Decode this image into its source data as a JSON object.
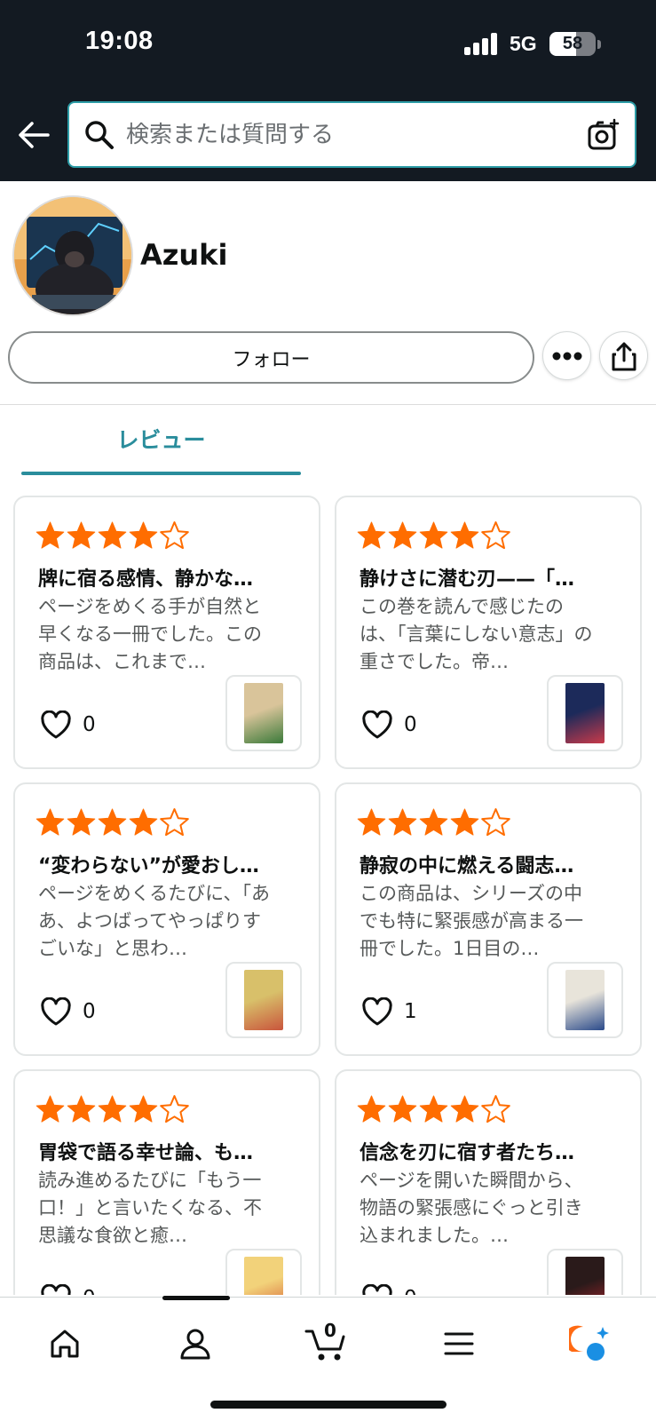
{
  "status_bar": {
    "time": "19:08",
    "network": "5G",
    "battery_percent": 58
  },
  "search": {
    "placeholder": "検索または質問する"
  },
  "profile": {
    "name": "Azuki",
    "follow_label": "フォロー"
  },
  "tabs": [
    {
      "label": "レビュー",
      "active": true
    }
  ],
  "reviews": [
    {
      "rating": 4,
      "title": "牌に宿る感情、静かな…",
      "body": "ページをめくる手が自然と早くなる一冊でした。この商品は、これまで…",
      "likes": "0",
      "cover_colors": [
        "#d9c49a",
        "#3b7a3a"
      ]
    },
    {
      "rating": 4,
      "title": "静けさに潜む刃——「…",
      "body": "この巻を読んで感じたのは、「言葉にしない意志」の重さでした。帝…",
      "likes": "0",
      "cover_colors": [
        "#1c2a5a",
        "#c93a4a"
      ]
    },
    {
      "rating": 4,
      "title": "“変わらない”が愛おし…",
      "body": "ページをめくるたびに、「ああ、よつばってやっぱりすごいな」と思わ…",
      "likes": "0",
      "cover_colors": [
        "#d8c06a",
        "#c9553c"
      ]
    },
    {
      "rating": 4,
      "title": "静寂の中に燃える闘志…",
      "body": "この商品は、シリーズの中でも特に緊張感が高まる一冊でした。1日目の…",
      "likes": "1",
      "cover_colors": [
        "#e8e4da",
        "#2a4a8a"
      ]
    },
    {
      "rating": 4,
      "title": "胃袋で語る幸せ論、も…",
      "body": "読み進めるたびに「もう一口！」と言いたくなる、不思議な食欲と癒…",
      "likes": "0",
      "cover_colors": [
        "#f2d27a",
        "#d2552d"
      ]
    },
    {
      "rating": 4,
      "title": "信念を刃に宿す者たち…",
      "body": "ページを開いた瞬間から、物語の緊張感にぐっと引き込まれました。…",
      "likes": "0",
      "cover_colors": [
        "#2a1a1a",
        "#b3262d"
      ]
    }
  ],
  "bottom_nav": {
    "cart_count": "0"
  },
  "colors": {
    "star": "#ff6d00",
    "accent": "#2a8d9c",
    "header_bg": "#131a22"
  }
}
